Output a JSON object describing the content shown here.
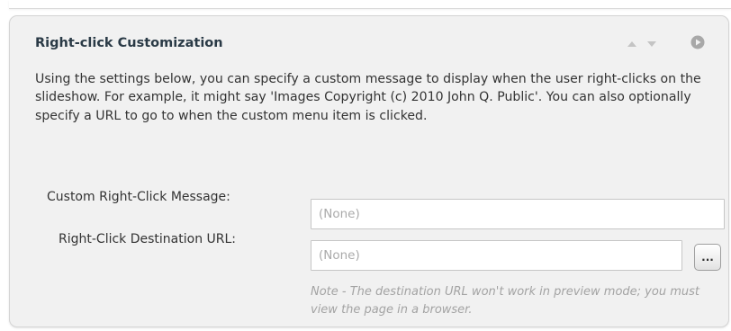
{
  "panel": {
    "title": "Right-click Customization",
    "description": "Using the settings below, you can specify a custom message to display when the user right-clicks on the slideshow.  For example, it might say 'Images Copyright (c) 2010 John Q. Public'.  You can also optionally specify a URL to go to when the custom menu item is clicked.",
    "icons": {
      "sort": "up-down-arrows-icon",
      "collapse": "circle-toggle-icon"
    }
  },
  "fields": {
    "message": {
      "label": "Custom Right-Click Message:",
      "value": "",
      "placeholder": "(None)"
    },
    "url": {
      "label": "Right-Click Destination URL:",
      "value": "",
      "placeholder": "(None)",
      "browse_label": "..."
    }
  },
  "note": "Note - The destination URL won't work in preview mode; you must view the page in a browser.",
  "colors": {
    "panel_background": "#f1f1f1",
    "title": "#2a3a46",
    "note": "#a3a3a3"
  }
}
